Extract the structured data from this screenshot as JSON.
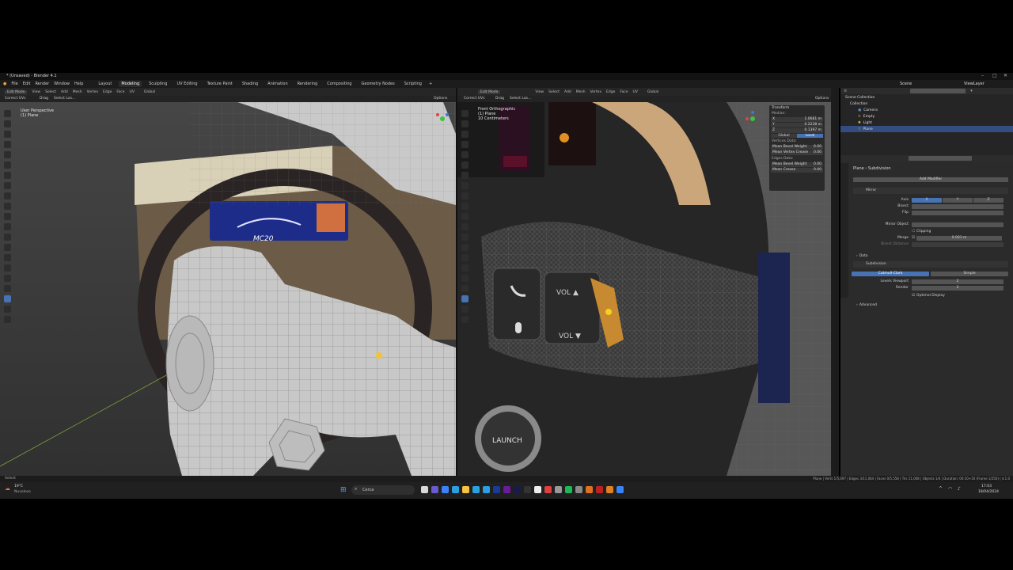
{
  "window": {
    "title": "* (Unsaved) - Blender 4.1"
  },
  "menu": {
    "items": [
      "File",
      "Edit",
      "Render",
      "Window",
      "Help"
    ],
    "workspaces": [
      "Layout",
      "Modeling",
      "Sculpting",
      "UV Editing",
      "Texture Paint",
      "Shading",
      "Animation",
      "Rendering",
      "Compositing",
      "Geometry Nodes",
      "Scripting"
    ],
    "active_workspace": "Modeling",
    "scene": "Scene",
    "view_layer": "ViewLayer"
  },
  "left_viewport": {
    "mode": "Edit Mode",
    "menus": [
      "View",
      "Select",
      "Add",
      "Mesh",
      "Vertex",
      "Edge",
      "Face",
      "UV"
    ],
    "orientation": "Global",
    "options": "Options",
    "sub_left": "Correct UVs",
    "sub_items": [
      "Drag",
      "Select Las..."
    ],
    "overlay_line1": "User Perspective",
    "overlay_line2": "(1) Plane",
    "dash_logo": "MC20"
  },
  "right_viewport": {
    "mode": "Edit Mode",
    "menus": [
      "View",
      "Select",
      "Add",
      "Mesh",
      "Vertex",
      "Edge",
      "Face",
      "UV"
    ],
    "orientation": "Global",
    "options": "Options",
    "sub_left": "Correct UVs",
    "sub_items": [
      "Drag",
      "Select Las..."
    ],
    "overlay_line1": "Front Orthographic",
    "overlay_line2": "(1) Plane",
    "overlay_line3": "10 Centimeters",
    "button_vol_up": "VOL ▲",
    "button_vol_down": "VOL ▼",
    "launch_label": "LAUNCH"
  },
  "n_panel": {
    "title": "Transform",
    "median": "Median:",
    "x_label": "X",
    "x_value": "1.0681 m",
    "y_label": "Y",
    "y_value": "0.2238 m",
    "z_label": "Z",
    "z_value": "0.1397 m",
    "global": "Global",
    "local": "Local",
    "vertices_data": "Vertices Data:",
    "mean_bevel_weight": "Mean Bevel Weight",
    "mean_bevel_weight_v": "0.00",
    "mean_vertex_crease": "Mean Vertex Crease",
    "mean_vertex_crease_v": "0.00",
    "edges_data": "Edges Data:",
    "edge_bevel": "Mean Bevel Weight",
    "edge_bevel_v": "0.00",
    "edge_crease": "Mean Crease",
    "edge_crease_v": "0.00"
  },
  "outliner": {
    "search_placeholder": "",
    "rows": [
      {
        "label": "Scene Collection",
        "selected": false
      },
      {
        "label": "Collection",
        "selected": false
      },
      {
        "label": "Camera",
        "selected": false
      },
      {
        "label": "Empty",
        "selected": false
      },
      {
        "label": "Light",
        "selected": false
      },
      {
        "label": "Plane",
        "selected": true
      }
    ]
  },
  "properties": {
    "breadcrumb_obj": "Plane",
    "breadcrumb_mod": "Subdivision",
    "add_modifier": "Add Modifier",
    "mirror_name": "Mirror",
    "axis": "Axis",
    "axis_vals": [
      "X",
      "Y",
      "Z"
    ],
    "bisect": "Bisect",
    "flip": "Flip",
    "mirror_object": "Mirror Object",
    "clipping": "Clipping",
    "merge": "Merge",
    "merge_value": "0.001 m",
    "bisect_distance": "Bisect Distance",
    "data_section": "Data",
    "subdiv_name": "Subdivision",
    "catmull": "Catmull-Clark",
    "simple": "Simple",
    "levels_viewport": "Levels Viewport",
    "levels_viewport_v": "2",
    "render": "Render",
    "render_v": "2",
    "optimal_display": "Optimal Display",
    "advanced": "Advanced"
  },
  "status_bar": {
    "left": "Select",
    "right": "Plane | Verts 1/5,497 | Edges 3/11,064 | Faces 0/5,558 | Tris 11,008 | Objects 1/4 | Duration: 00:10+10 (Frame 1/250) | 4.1.0"
  },
  "taskbar": {
    "weather_temp": "19°C",
    "weather_text": "Nuvoloso",
    "search": "Cerca",
    "time": "17:03",
    "date": "18/04/2024"
  },
  "colors": {
    "accent": "#4772b3",
    "selected_row": "#334d80",
    "vertex_highlight": "#f0a020"
  }
}
